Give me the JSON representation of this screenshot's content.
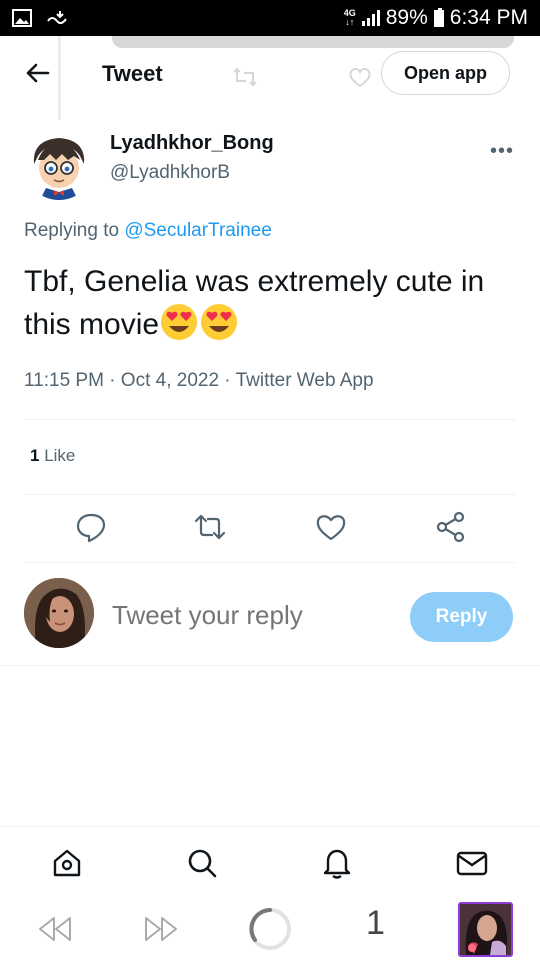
{
  "status_bar": {
    "network": "4G",
    "battery": "89%",
    "time": "6:34 PM"
  },
  "header": {
    "title": "Tweet",
    "open_app_label": "Open app"
  },
  "tweet": {
    "display_name": "Lyadhkhor_Bong",
    "handle": "@LyadhkhorB",
    "more_label": "•••",
    "replying_prefix": "Replying to",
    "replying_to": "@SecularTrainee",
    "text": "Tbf, Genelia was extremely cute in this movie",
    "meta": "11:15 PM · Oct 4, 2022 · Twitter Web App",
    "like_count": "1",
    "like_label": "Like"
  },
  "composer": {
    "placeholder": "Tweet your reply",
    "reply_label": "Reply"
  },
  "browser": {
    "tab_count": "1"
  },
  "colors": {
    "accent": "#1d9bf0",
    "reply_button": "#8ecdf8",
    "secondary_text": "#536471"
  }
}
